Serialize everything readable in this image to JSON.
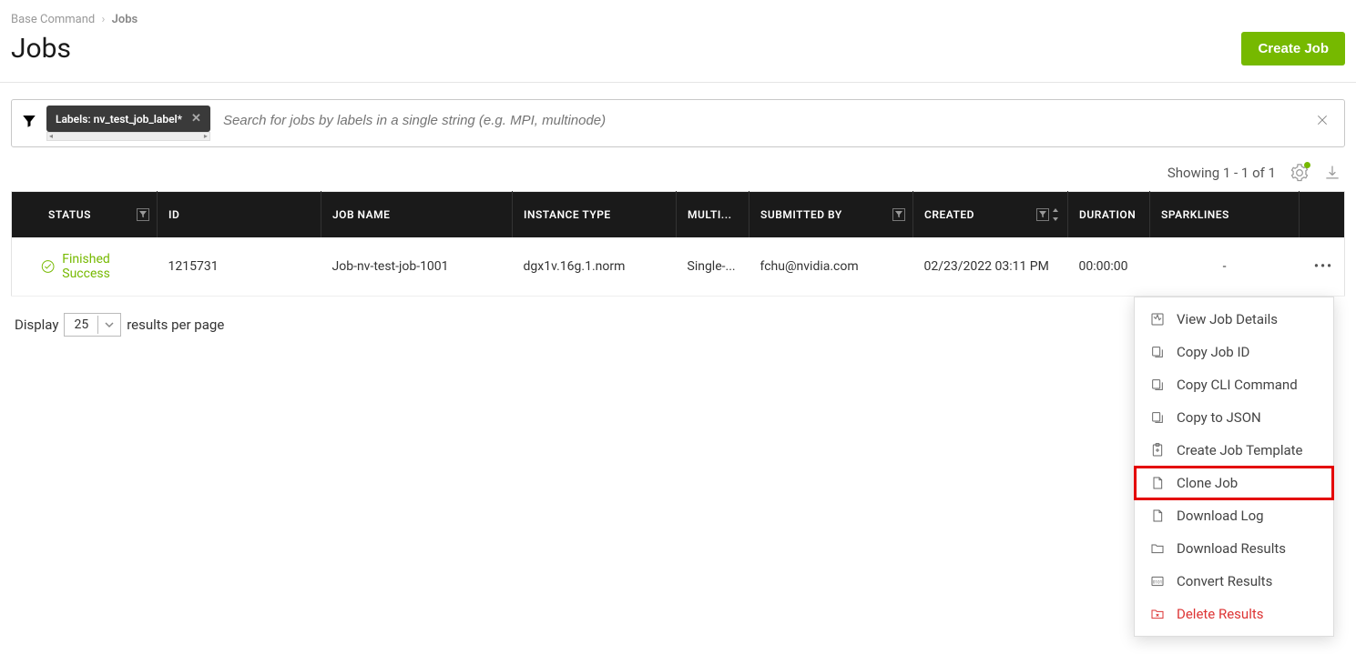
{
  "breadcrumb": {
    "parent": "Base Command",
    "current": "Jobs"
  },
  "page": {
    "title": "Jobs",
    "create_btn": "Create Job"
  },
  "search": {
    "chip": "Labels: nv_test_job_label*",
    "placeholder": "Search for jobs by labels in a single string (e.g. MPI, multinode)"
  },
  "toolbar": {
    "showing": "Showing 1 - 1 of 1"
  },
  "table": {
    "headers": {
      "status": "STATUS",
      "id": "ID",
      "job_name": "JOB NAME",
      "instance_type": "INSTANCE TYPE",
      "multi": "MULTI...",
      "submitted_by": "SUBMITTED BY",
      "created": "CREATED",
      "duration": "DURATION",
      "sparklines": "SPARKLINES"
    },
    "row": {
      "status": "Finished Success",
      "id": "1215731",
      "job_name": "Job-nv-test-job-1001",
      "instance_type": "dgx1v.16g.1.norm",
      "multi": "Single-...",
      "submitted_by": "fchu@nvidia.com",
      "created": "02/23/2022 03:11 PM",
      "duration": "00:00:00",
      "sparklines": "-"
    }
  },
  "pagination": {
    "display": "Display",
    "value": "25",
    "suffix": "results per page"
  },
  "menu": {
    "view_details": "View Job Details",
    "copy_job_id": "Copy Job ID",
    "copy_cli": "Copy CLI Command",
    "copy_json": "Copy to JSON",
    "create_template": "Create Job Template",
    "clone_job": "Clone Job",
    "download_log": "Download Log",
    "download_results": "Download Results",
    "convert_results": "Convert Results",
    "delete_results": "Delete Results"
  }
}
